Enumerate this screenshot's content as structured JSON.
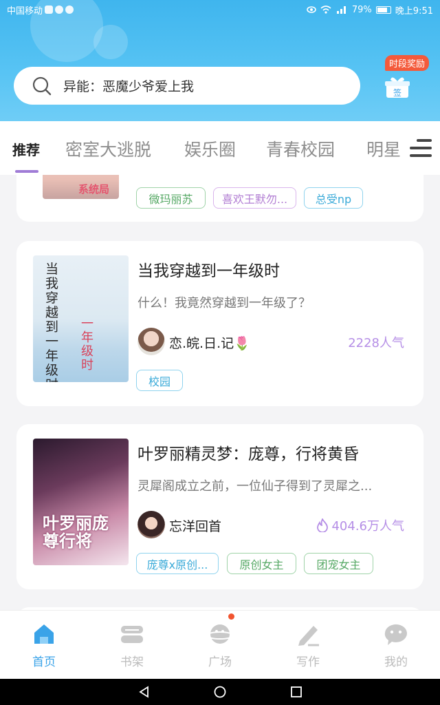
{
  "status_bar": {
    "carrier": "中国移动",
    "battery": "79%",
    "time": "晚上9:51"
  },
  "search": {
    "placeholder": "异能：恶魔少爷爱上我"
  },
  "gift": {
    "badge": "时段奖励",
    "label": "签"
  },
  "tabs": [
    {
      "label": "推荐",
      "active": true
    },
    {
      "label": "密室大逃脱"
    },
    {
      "label": "娱乐圈"
    },
    {
      "label": "青春校园"
    },
    {
      "label": "明星"
    }
  ],
  "cards": [
    {
      "cover_text": "系统局",
      "tags": [
        "微玛丽苏",
        "喜欢王默勿...",
        "总受np"
      ]
    },
    {
      "title": "当我穿越到一年级时",
      "description": "什么！我竟然穿越到一年级了？",
      "author": "恋.皖.日.记🌷",
      "popularity": "2228人气",
      "cover_text": "当我穿越到一年级时",
      "tags": [
        "校园"
      ]
    },
    {
      "title": "叶罗丽精灵梦：庞尊，行将黄昏",
      "description": "灵犀阁成立之前，一位仙子得到了灵犀之...",
      "author": "忘洋回首",
      "popularity": "404.6万人气",
      "cover_text": "叶罗丽庞尊行将",
      "tags": [
        "庞尊x原创...",
        "原创女主",
        "团宠女主"
      ]
    }
  ],
  "bottom_nav": [
    {
      "label": "首页",
      "icon": "home-icon",
      "active": true
    },
    {
      "label": "书架",
      "icon": "bookshelf-icon"
    },
    {
      "label": "广场",
      "icon": "planet-icon"
    },
    {
      "label": "写作",
      "icon": "pen-icon"
    },
    {
      "label": "我的",
      "icon": "chat-face-icon"
    }
  ],
  "colors": {
    "header": "#3fb5ee",
    "accent_purple": "#b58ee6",
    "active_nav": "#3aa3e8",
    "badge_red": "#f45a3b"
  }
}
